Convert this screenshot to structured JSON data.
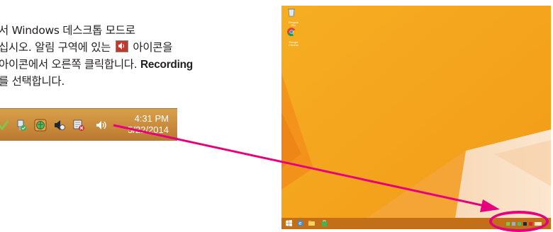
{
  "instruction": {
    "line1": "서 Windows 데스크톱 모드로",
    "line2_before_icon": "십시오. 알림 구역에 있는 ",
    "line2_after_icon": " 아이콘을",
    "line3_text": "아이콘에서 오른쪽 클릭합니다. ",
    "line3_bold": "Recording",
    "line4": "를 선택합니다."
  },
  "taskbar_crop": {
    "time": "4:31 PM",
    "date": "5/22/2014",
    "icons": [
      "checkmark-icon",
      "usb-icon",
      "network-globe-icon",
      "speaker-muted-icon",
      "action-center-icon",
      "volume-icon"
    ]
  },
  "desktop": {
    "desktop_icons": [
      {
        "name": "recycle-bin-icon",
        "label": "Recycle Bin"
      },
      {
        "name": "chrome-icon",
        "label": "Google Chrome"
      }
    ],
    "taskbar_buttons": [
      "start-icon",
      "internet-explorer-icon",
      "file-explorer-icon",
      "store-icon"
    ]
  },
  "colors": {
    "desktop_bg": "#f3a21d",
    "arrow": "#e6007e",
    "tray_bg": "#c8893a"
  }
}
